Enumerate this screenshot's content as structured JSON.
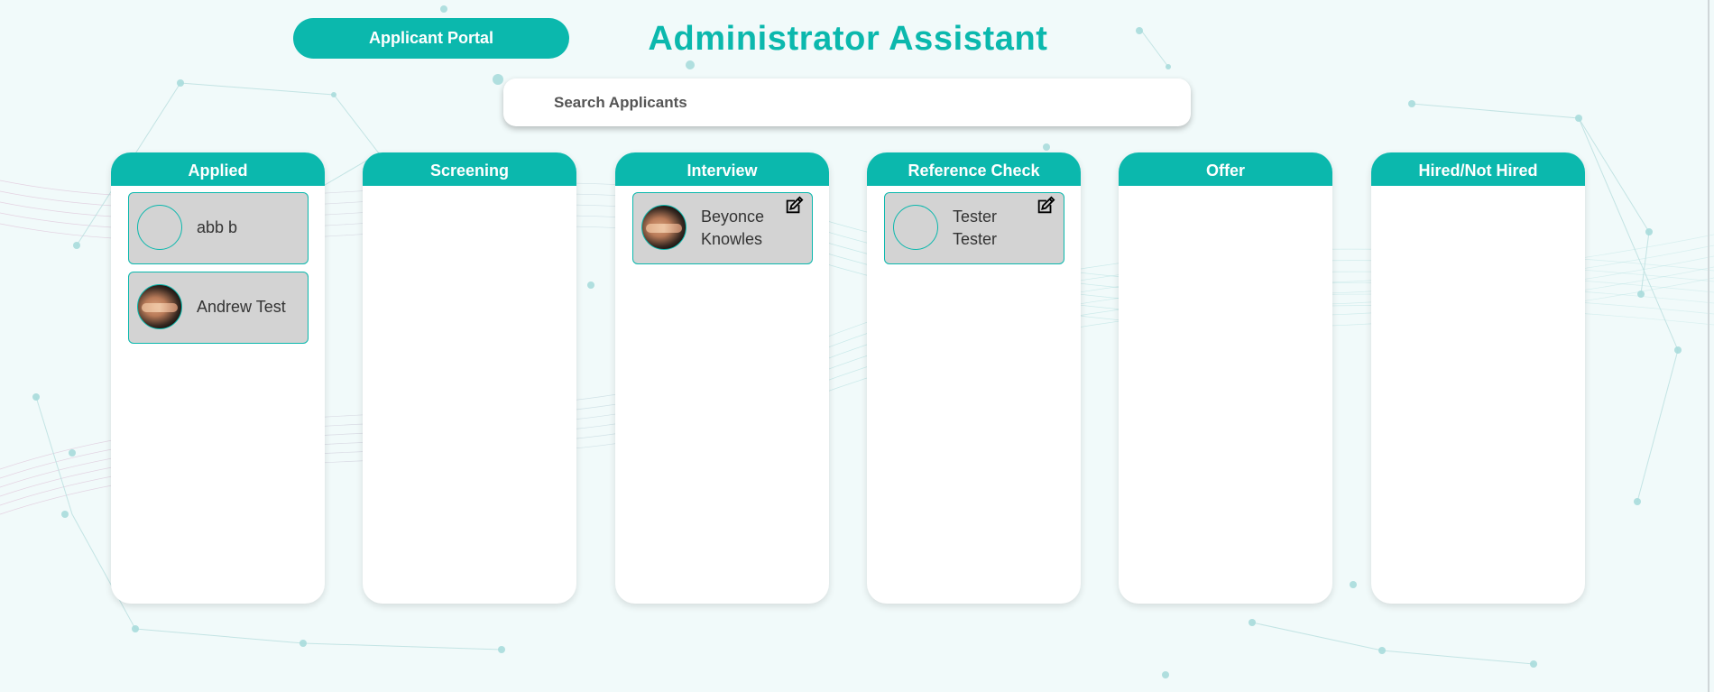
{
  "header": {
    "portal_button": "Applicant Portal",
    "title": "Administrator Assistant"
  },
  "search": {
    "placeholder": "Search Applicants",
    "value": ""
  },
  "colors": {
    "accent": "#0bb8ad",
    "card": "#d3d3d3",
    "background": "#f1fafa"
  },
  "columns": [
    {
      "title": "Applied",
      "cards": [
        {
          "name": "abb b",
          "photo": false,
          "edit_icon": false
        },
        {
          "name": "Andrew Test",
          "photo": true,
          "edit_icon": false
        }
      ]
    },
    {
      "title": "Screening",
      "cards": []
    },
    {
      "title": "Interview",
      "cards": [
        {
          "name": "Beyonce Knowles",
          "photo": true,
          "edit_icon": true
        }
      ]
    },
    {
      "title": "Reference Check",
      "cards": [
        {
          "name": "Tester Tester",
          "photo": false,
          "edit_icon": true
        }
      ]
    },
    {
      "title": "Offer",
      "cards": []
    },
    {
      "title": "Hired/Not Hired",
      "cards": []
    }
  ],
  "icons": {
    "edit": "edit-icon",
    "avatar": "avatar"
  }
}
